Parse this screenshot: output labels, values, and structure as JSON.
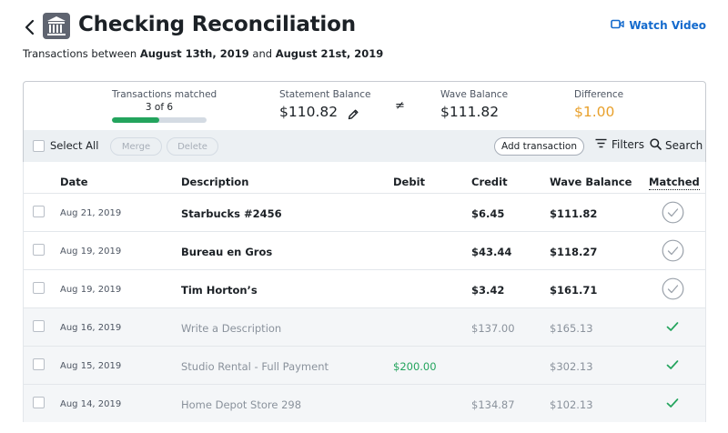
{
  "header": {
    "title": "Checking Reconciliation",
    "watch_video": "Watch Video",
    "subtitle_prefix": "Transactions between",
    "start_date": "August 13th, 2019",
    "subtitle_and": "and",
    "end_date": "August 21st, 2019"
  },
  "summary": {
    "matched_label": "Transactions matched",
    "matched_count": "3 of 6",
    "matched_progress": 0.5,
    "statement_label": "Statement Balance",
    "statement_value": "$110.82",
    "not_equal": "≠",
    "wave_label": "Wave Balance",
    "wave_value": "$111.82",
    "difference_label": "Difference",
    "difference_value": "$1.00",
    "difference_color": "#e8a02b"
  },
  "toolbar": {
    "select_all": "Select All",
    "merge": "Merge",
    "delete": "Delete",
    "add_transaction": "Add transaction",
    "filters": "Filters",
    "search": "Search"
  },
  "columns": {
    "date": "Date",
    "description": "Description",
    "debit": "Debit",
    "credit": "Credit",
    "wave_balance": "Wave Balance",
    "matched": "Matched"
  },
  "rows": [
    {
      "date": "Aug 21, 2019",
      "description": "Starbucks #2456",
      "debit": "",
      "credit": "$6.45",
      "balance": "$111.82",
      "matched": false
    },
    {
      "date": "Aug 19, 2019",
      "description": "Bureau en Gros",
      "debit": "",
      "credit": "$43.44",
      "balance": "$118.27",
      "matched": false
    },
    {
      "date": "Aug 19, 2019",
      "description": "Tim Horton’s",
      "debit": "",
      "credit": "$3.42",
      "balance": "$161.71",
      "matched": false
    },
    {
      "date": "Aug 16, 2019",
      "description": "Write a Description",
      "debit": "",
      "credit": "$137.00",
      "balance": "$165.13",
      "matched": true
    },
    {
      "date": "Aug 15, 2019",
      "description": "Studio Rental - Full Payment",
      "debit": "$200.00",
      "credit": "",
      "balance": "$302.13",
      "matched": true
    },
    {
      "date": "Aug 14, 2019",
      "description": "Home Depot Store 298",
      "debit": "",
      "credit": "$134.87",
      "balance": "$102.13",
      "matched": true
    }
  ],
  "colors": {
    "accent_blue": "#136acd",
    "match_green": "#23a45d",
    "difference_orange": "#e8a02b"
  }
}
